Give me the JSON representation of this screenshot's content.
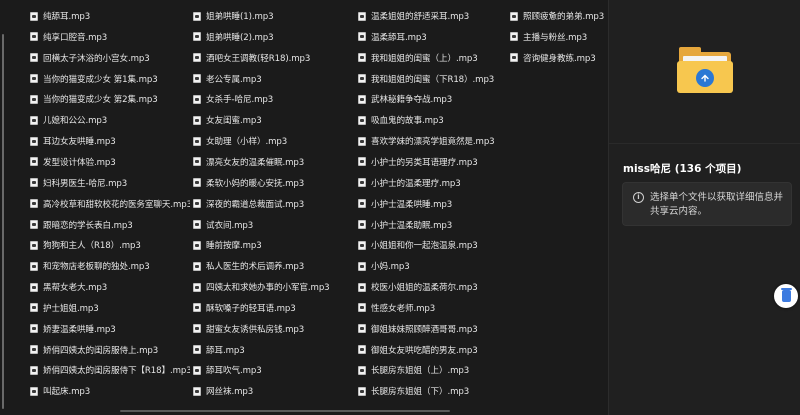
{
  "file_columns": [
    [
      "纯舔耳.mp3",
      "纯享口腔音.mp3",
      "回横太子沐浴的小宫女.mp3",
      "当你的猫变成少女 第1集.mp3",
      "当你的猫变成少女 第2集.mp3",
      "儿媳和公公.mp3",
      "耳边女友哄睡.mp3",
      "发型设计体验.mp3",
      "妇科男医生-哈尼.mp3",
      "高冷校草和甜软校花的医务室聊天.mp3",
      "跟暗恋的学长表白.mp3",
      "狗狗和主人（R18）.mp3",
      "和宠物店老板聊的独处.mp3",
      "黑帮女老大.mp3",
      "护士姐姐.mp3",
      "娇妻温柔哄睡.mp3",
      "娇俏四姨太的闺房服侍上.mp3",
      "娇俏四姨太的闺房服侍下【R18】.mp3",
      "叫起床.mp3"
    ],
    [
      "姐弟哄睡(1).mp3",
      "姐弟哄睡(2).mp3",
      "酒吧女王调教(轻R18).mp3",
      "老公专属.mp3",
      "女杀手-哈尼.mp3",
      "女友闺蜜.mp3",
      "女助理（小样）.mp3",
      "漂亮女友的温柔催眠.mp3",
      "柔软小妈的暖心安抚.mp3",
      "深夜的霸道总裁面试.mp3",
      "试衣间.mp3",
      "睡前按摩.mp3",
      "私人医生的术后调养.mp3",
      "四姨太和求她办事的小军官.mp3",
      "酥软嗓子的轻耳语.mp3",
      "甜蜜女友诱供私房钱.mp3",
      "舔耳.mp3",
      "舔耳吹气.mp3",
      "网丝袜.mp3"
    ],
    [
      "温柔姐姐的舒适采耳.mp3",
      "温柔舔耳.mp3",
      "我和姐姐的闺蜜（上）.mp3",
      "我和姐姐的闺蜜（下R18）.mp3",
      "武林秘籍争夺战.mp3",
      "吸血鬼的故事.mp3",
      "喜欢学妹的漂亮学姐竟然是.mp3",
      "小护士的另类耳语理疗.mp3",
      "小护士的温柔理疗.mp3",
      "小护士温柔哄睡.mp3",
      "小护士温柔助眠.mp3",
      "小姐姐和你一起泡温泉.mp3",
      "小妈.mp3",
      "校医小姐姐的温柔荷尔.mp3",
      "性感女老师.mp3",
      "御姐妹妹照顾醉酒哥哥.mp3",
      "御姐女友哄吃醋的男友.mp3",
      "长腿房东姐姐（上）.mp3",
      "长腿房东姐姐（下）.mp3"
    ],
    [
      "照顾疲惫的弟弟.mp3",
      "主播与粉丝.mp3",
      "咨询健身教练.mp3"
    ]
  ],
  "details": {
    "folder_title": "miss哈尼 (136 个项目)",
    "info_text": "选择单个文件以获取详细信息并共享云内容。"
  },
  "icons": {
    "file": "audio-file-icon",
    "folder": "folder-icon",
    "info": "info-icon",
    "floating": "recycle-bin-icon"
  },
  "colors": {
    "background": "#1b1b1b",
    "pane": "#202020",
    "folder": "#f7c74f",
    "badge": "#2a78d4"
  }
}
